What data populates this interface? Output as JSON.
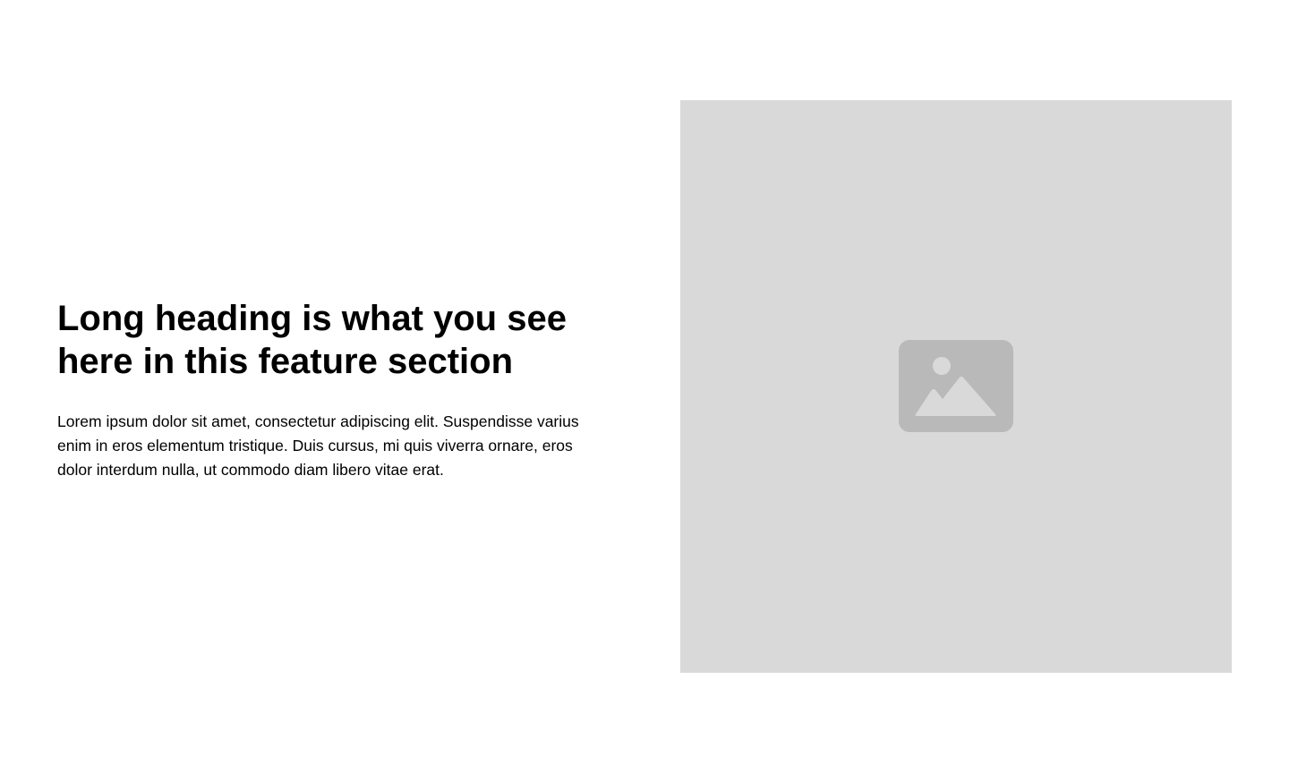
{
  "feature": {
    "heading": "Long heading is what you see here in this feature section",
    "body": "Lorem ipsum dolor sit amet, consectetur adipiscing elit. Suspendisse varius enim in eros elementum tristique. Duis cursus, mi quis viverra ornare, eros dolor interdum nulla, ut commodo diam libero vitae erat."
  },
  "image": {
    "icon": "image-icon",
    "background_color": "#d9d9d9",
    "icon_color": "#b9b9b9"
  }
}
